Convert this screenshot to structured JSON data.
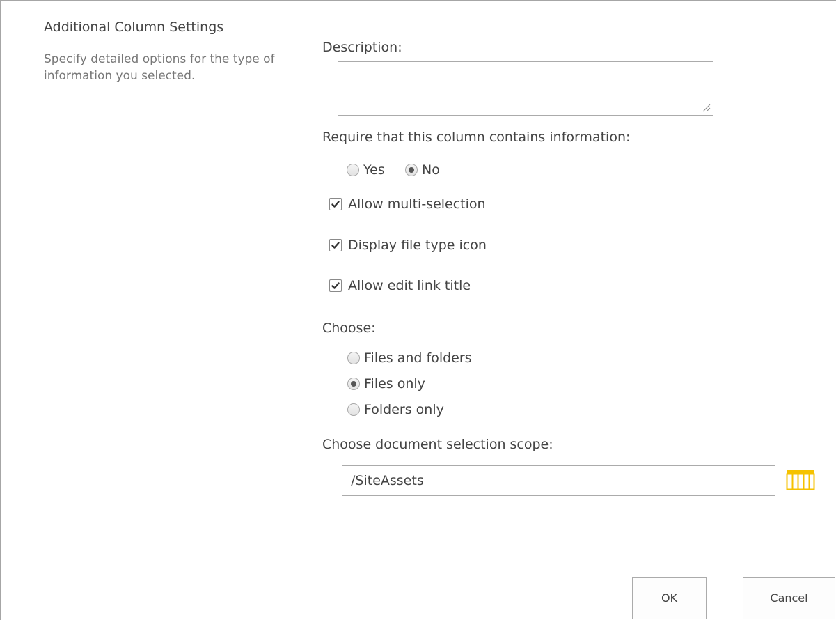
{
  "section": {
    "title": "Additional Column Settings",
    "description": "Specify detailed options for the type of information you selected."
  },
  "description_field": {
    "label": "Description:",
    "value": "",
    "placeholder": ""
  },
  "require": {
    "label": "Require that this column contains information:",
    "options": [
      {
        "label": "Yes",
        "selected": false
      },
      {
        "label": "No",
        "selected": true
      }
    ]
  },
  "checkboxes": [
    {
      "label": "Allow multi-selection",
      "checked": true
    },
    {
      "label": "Display file type icon",
      "checked": true
    },
    {
      "label": "Allow edit link title",
      "checked": true
    }
  ],
  "choose": {
    "label": "Choose:",
    "options": [
      {
        "label": "Files and folders",
        "selected": false
      },
      {
        "label": "Files only",
        "selected": true
      },
      {
        "label": "Folders only",
        "selected": false
      }
    ]
  },
  "scope": {
    "label": "Choose document selection scope:",
    "value": "/SiteAssets",
    "browse_icon": "browse-icon"
  },
  "buttons": {
    "ok": "OK",
    "cancel": "Cancel"
  },
  "colors": {
    "browse_icon": "#f5c200",
    "border": "#ababab",
    "text": "#444444",
    "muted_text": "#777777"
  }
}
